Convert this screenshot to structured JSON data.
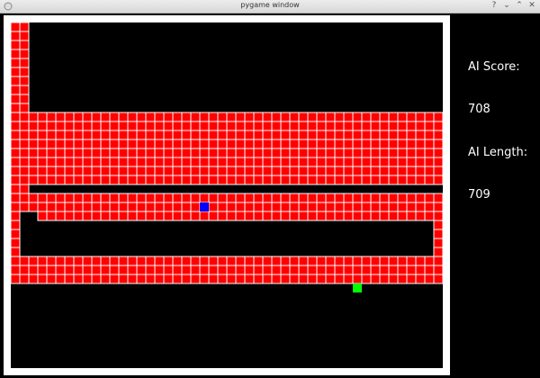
{
  "window": {
    "title": "pygame window",
    "controls": [
      {
        "name": "help-button",
        "glyph": "?"
      },
      {
        "name": "minimize-button",
        "glyph": "⌄"
      },
      {
        "name": "maximize-button",
        "glyph": "⌃"
      },
      {
        "name": "close-button",
        "glyph": "✕"
      }
    ]
  },
  "scoreboard": {
    "score_label": "AI Score:",
    "score_value": "708",
    "length_label": "AI Length:",
    "length_value": "709"
  },
  "colors": {
    "snake_body": "#ff0000",
    "snake_grid": "#ffffff",
    "snake_head": "#0000ff",
    "food": "#00ff00",
    "board_bg": "#000000"
  }
}
